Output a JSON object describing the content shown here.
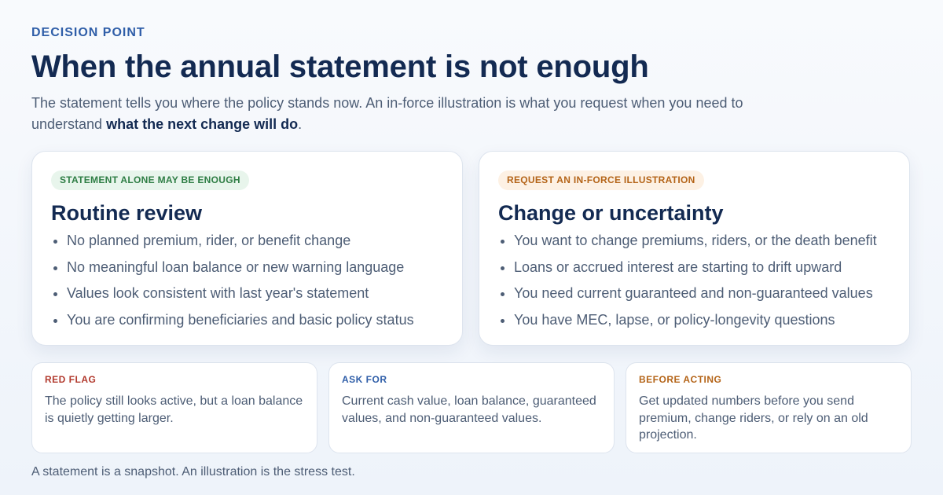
{
  "header": {
    "eyebrow": "DECISION POINT",
    "title": "When the annual statement is not enough",
    "subtitle_lead": "The statement tells you where the policy stands now. An in-force illustration is what you request when you need to understand ",
    "subtitle_emphasis": "what the next change will do",
    "subtitle_end": "."
  },
  "cards": [
    {
      "badge": "STATEMENT ALONE MAY BE ENOUGH",
      "badge_color": "#2e7d44",
      "title": "Routine review",
      "items": [
        "No planned premium, rider, or benefit change",
        "No meaningful loan balance or new warning language",
        "Values look consistent with last year's statement",
        "You are confirming beneficiaries and basic policy status"
      ]
    },
    {
      "badge": "REQUEST AN IN-FORCE ILLUSTRATION",
      "badge_color": "#b46418",
      "title": "Change or uncertainty",
      "items": [
        "You want to change premiums, riders, or the death benefit",
        "Loans or accrued interest are starting to drift upward",
        "You need current guaranteed and non-guaranteed values",
        "You have MEC, lapse, or policy-longevity questions"
      ]
    }
  ],
  "notes": [
    {
      "label": "RED FLAG",
      "color": "#b23a2e",
      "text": "The policy still looks active, but a loan balance is quietly getting larger."
    },
    {
      "label": "ASK FOR",
      "color": "#2f5ea8",
      "text": "Current cash value, loan balance, guaranteed values, and non-guaranteed values."
    },
    {
      "label": "BEFORE ACTING",
      "color": "#b46418",
      "text": "Get updated numbers before you send premium, change riders, or rely on an old projection."
    }
  ],
  "footer": "A statement is a snapshot. An illustration is the stress test."
}
